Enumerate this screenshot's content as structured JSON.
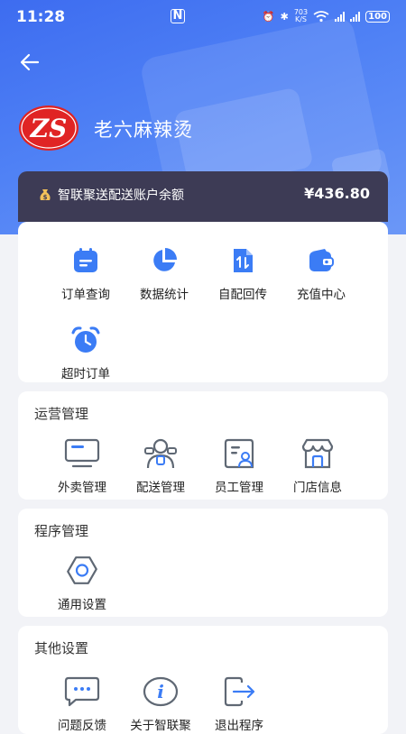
{
  "status_bar": {
    "time": "11:28",
    "nfc": "N",
    "net_speed_top": "703",
    "net_speed_bottom": "K/S",
    "battery": "100"
  },
  "header": {
    "logo_text": "ZS",
    "store_name": "老六麻辣烫"
  },
  "balance": {
    "label": "智联聚送配送账户余额",
    "amount": "¥436.80"
  },
  "quick_menu": {
    "items": [
      {
        "label": "订单查询",
        "icon": "calendar-icon"
      },
      {
        "label": "数据统计",
        "icon": "pie-chart-icon"
      },
      {
        "label": "自配回传",
        "icon": "transfer-document-icon"
      },
      {
        "label": "充值中心",
        "icon": "wallet-icon"
      },
      {
        "label": "超时订单",
        "icon": "alarm-clock-icon"
      }
    ]
  },
  "operations": {
    "title": "运营管理",
    "items": [
      {
        "label": "外卖管理",
        "icon": "monitor-icon"
      },
      {
        "label": "配送管理",
        "icon": "courier-icon"
      },
      {
        "label": "员工管理",
        "icon": "employee-card-icon"
      },
      {
        "label": "门店信息",
        "icon": "storefront-icon"
      }
    ]
  },
  "program": {
    "title": "程序管理",
    "items": [
      {
        "label": "通用设置",
        "icon": "gear-icon"
      }
    ]
  },
  "other": {
    "title": "其他设置",
    "items": [
      {
        "label": "问题反馈",
        "icon": "chat-bubble-icon"
      },
      {
        "label": "关于智联聚",
        "icon": "info-icon"
      },
      {
        "label": "退出程序",
        "icon": "exit-icon"
      }
    ]
  },
  "colors": {
    "accent_blue": "#3b7cf5",
    "outline_gray": "#5f6874",
    "balance_bg": "#3d3b55",
    "hero_blue": "#4a78f2",
    "logo_red": "#e02424"
  }
}
